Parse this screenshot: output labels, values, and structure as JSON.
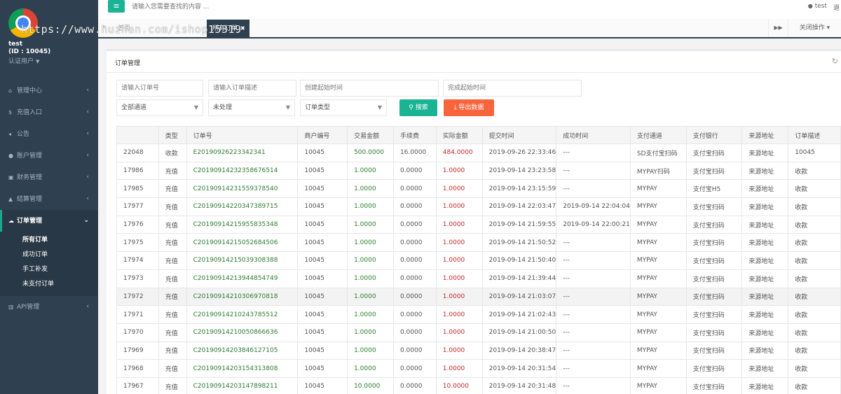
{
  "sidebar": {
    "user": {
      "name": "test",
      "id": "(ID : 10045)",
      "role": "认证用户"
    },
    "menu": [
      {
        "label": "管理中心",
        "icon": "home-icon"
      },
      {
        "label": "充值入口",
        "icon": "dollar-icon"
      },
      {
        "label": "公告",
        "icon": "megaphone-icon"
      },
      {
        "label": "账户管理",
        "icon": "user-icon"
      },
      {
        "label": "财务管理",
        "icon": "money-icon"
      },
      {
        "label": "结算管理",
        "icon": "chart-icon"
      },
      {
        "label": "订单管理",
        "icon": "cloud-icon"
      },
      {
        "label": "API管理",
        "icon": "bank-icon"
      }
    ],
    "submenu": [
      "所有订单",
      "成功订单",
      "手工补发",
      "未支付订单"
    ]
  },
  "topbar": {
    "search_placeholder": "请输入您需要查找的内容 ...",
    "user": "test",
    "edge_text": "退"
  },
  "tabs": {
    "items": [
      "首页",
      "所有订单"
    ],
    "active": "所有订单",
    "close_ops": "关闭操作"
  },
  "watermark": "https://www.huzhan.com/ishop15319",
  "panel": {
    "title": "订单管理",
    "filters": {
      "order_no_placeholder": "请输入订单号",
      "order_desc_placeholder": "请输入订单描述",
      "create_time_placeholder": "创建起始时间",
      "finish_time_placeholder": "完成起始时间",
      "channel": "全部通道",
      "status": "未处理",
      "order_type": "订单类型",
      "search_label": "搜索",
      "export_label": "导出数据"
    }
  },
  "table": {
    "headers": [
      "",
      "类型",
      "订单号",
      "商户编号",
      "交易金额",
      "手续费",
      "实际金额",
      "提交时间",
      "成功时间",
      "支付通道",
      "支付银行",
      "来源地址",
      "订单描述"
    ],
    "rows": [
      [
        "22048",
        "收款",
        "E20190926223342341",
        "10045",
        "500.0000",
        "16.0000",
        "484.0000",
        "2019-09-26 22:33:46",
        "---",
        "SD支付宝扫码",
        "支付宝扫码",
        "来源地址",
        "10045"
      ],
      [
        "17986",
        "充值",
        "C20190914232358676514",
        "10045",
        "1.0000",
        "0.0000",
        "1.0000",
        "2019-09-14 23:23:58",
        "---",
        "MYPAY扫码",
        "支付宝扫码",
        "来源地址",
        "收款"
      ],
      [
        "17985",
        "充值",
        "C20190914231559378540",
        "10045",
        "1.0000",
        "0.0000",
        "1.0000",
        "2019-09-14 23:15:59",
        "---",
        "MYPAY",
        "支付宝H5",
        "来源地址",
        "收款"
      ],
      [
        "17977",
        "充值",
        "C20190914220347389715",
        "10045",
        "1.0000",
        "0.0000",
        "1.0000",
        "2019-09-14 22:03:47",
        "2019-09-14 22:04:04",
        "MYPAY",
        "支付宝扫码",
        "来源地址",
        "收款"
      ],
      [
        "17976",
        "充值",
        "C20190914215955835348",
        "10045",
        "1.0000",
        "0.0000",
        "1.0000",
        "2019-09-14 21:59:55",
        "2019-09-14 22:00:21",
        "MYPAY",
        "支付宝扫码",
        "来源地址",
        "收款"
      ],
      [
        "17975",
        "充值",
        "C20190914215052684506",
        "10045",
        "1.0000",
        "0.0000",
        "1.0000",
        "2019-09-14 21:50:52",
        "---",
        "MYPAY",
        "支付宝扫码",
        "来源地址",
        "收款"
      ],
      [
        "17974",
        "充值",
        "C20190914215039308388",
        "10045",
        "1.0000",
        "0.0000",
        "1.0000",
        "2019-09-14 21:50:40",
        "---",
        "MYPAY",
        "支付宝扫码",
        "来源地址",
        "收款"
      ],
      [
        "17973",
        "充值",
        "C20190914213944854749",
        "10045",
        "1.0000",
        "0.0000",
        "1.0000",
        "2019-09-14 21:39:44",
        "---",
        "MYPAY",
        "支付宝扫码",
        "来源地址",
        "收款"
      ],
      [
        "17972",
        "充值",
        "C20190914210306970818",
        "10045",
        "1.0000",
        "0.0000",
        "1.0000",
        "2019-09-14 21:03:07",
        "---",
        "MYPAY",
        "支付宝扫码",
        "来源地址",
        "收款"
      ],
      [
        "17971",
        "充值",
        "C20190914210243785512",
        "10045",
        "1.0000",
        "0.0000",
        "1.0000",
        "2019-09-14 21:02:43",
        "---",
        "MYPAY",
        "支付宝扫码",
        "来源地址",
        "收款"
      ],
      [
        "17970",
        "充值",
        "C20190914210050866636",
        "10045",
        "1.0000",
        "0.0000",
        "1.0000",
        "2019-09-14 21:00:50",
        "---",
        "MYPAY",
        "支付宝扫码",
        "来源地址",
        "收款"
      ],
      [
        "17969",
        "充值",
        "C20190914203846127105",
        "10045",
        "1.0000",
        "0.0000",
        "1.0000",
        "2019-09-14 20:38:47",
        "---",
        "MYPAY",
        "支付宝扫码",
        "来源地址",
        "收款"
      ],
      [
        "17968",
        "充值",
        "C20190914203154313808",
        "10045",
        "1.0000",
        "0.0000",
        "1.0000",
        "2019-09-14 20:31:54",
        "---",
        "MYPAY",
        "支付宝扫码",
        "来源地址",
        "收款"
      ],
      [
        "17967",
        "充值",
        "C20190914203147898211",
        "10045",
        "10.0000",
        "0.0000",
        "10.0000",
        "2019-09-14 20:31:48",
        "---",
        "MYPAY",
        "支付宝扫码",
        "来源地址",
        "收款"
      ]
    ]
  },
  "colors": {
    "sidebar": "#2f4050",
    "accent": "#1ab394",
    "export": "#f8653c",
    "amount_green": "#2e7d32",
    "amount_red": "#c62828"
  }
}
